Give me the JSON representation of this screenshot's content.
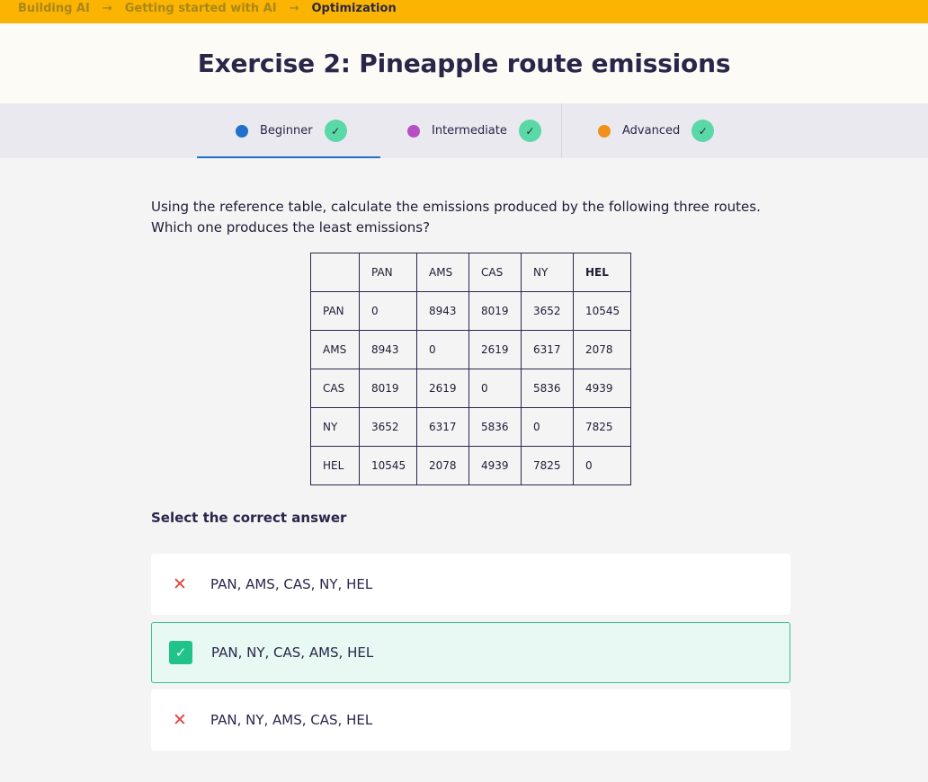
{
  "breadcrumb": {
    "items": [
      "Building AI",
      "Getting started with AI",
      "Optimization"
    ],
    "separator": "→"
  },
  "page": {
    "title": "Exercise 2: Pineapple route emissions"
  },
  "levels": [
    {
      "label": "Beginner",
      "color": "#2170c9",
      "completed": true,
      "active": true,
      "check": "✓"
    },
    {
      "label": "Intermediate",
      "color": "#b84fc2",
      "completed": true,
      "active": false,
      "check": "✓"
    },
    {
      "label": "Advanced",
      "color": "#f0901b",
      "completed": true,
      "active": false,
      "check": "✓"
    }
  ],
  "question": {
    "line1": "Using the reference table, calculate the emissions produced by the following three routes.",
    "line2": "Which one produces the least emissions?"
  },
  "table": {
    "headers": [
      "",
      "PAN",
      "AMS",
      "CAS",
      "NY",
      "HEL"
    ],
    "rows": [
      [
        "PAN",
        "0",
        "8943",
        "8019",
        "3652",
        "10545"
      ],
      [
        "AMS",
        "8943",
        "0",
        "2619",
        "6317",
        "2078"
      ],
      [
        "CAS",
        "8019",
        "2619",
        "0",
        "5836",
        "4939"
      ],
      [
        "NY",
        "3652",
        "6317",
        "5836",
        "0",
        "7825"
      ],
      [
        "HEL",
        "10545",
        "2078",
        "4939",
        "7825",
        "0"
      ]
    ]
  },
  "answers": {
    "label": "Select the correct answer",
    "options": [
      {
        "text": "PAN, AMS, CAS, NY, HEL",
        "status": "incorrect",
        "icon": "✕"
      },
      {
        "text": "PAN, NY, CAS, AMS, HEL",
        "status": "correct",
        "icon": "✓"
      },
      {
        "text": "PAN, NY, AMS, CAS, HEL",
        "status": "incorrect",
        "icon": "✕"
      }
    ]
  },
  "colors": {
    "accent": "#fbb401",
    "correct": "#20c48a",
    "incorrect": "#e0433a",
    "text": "#29264a"
  }
}
